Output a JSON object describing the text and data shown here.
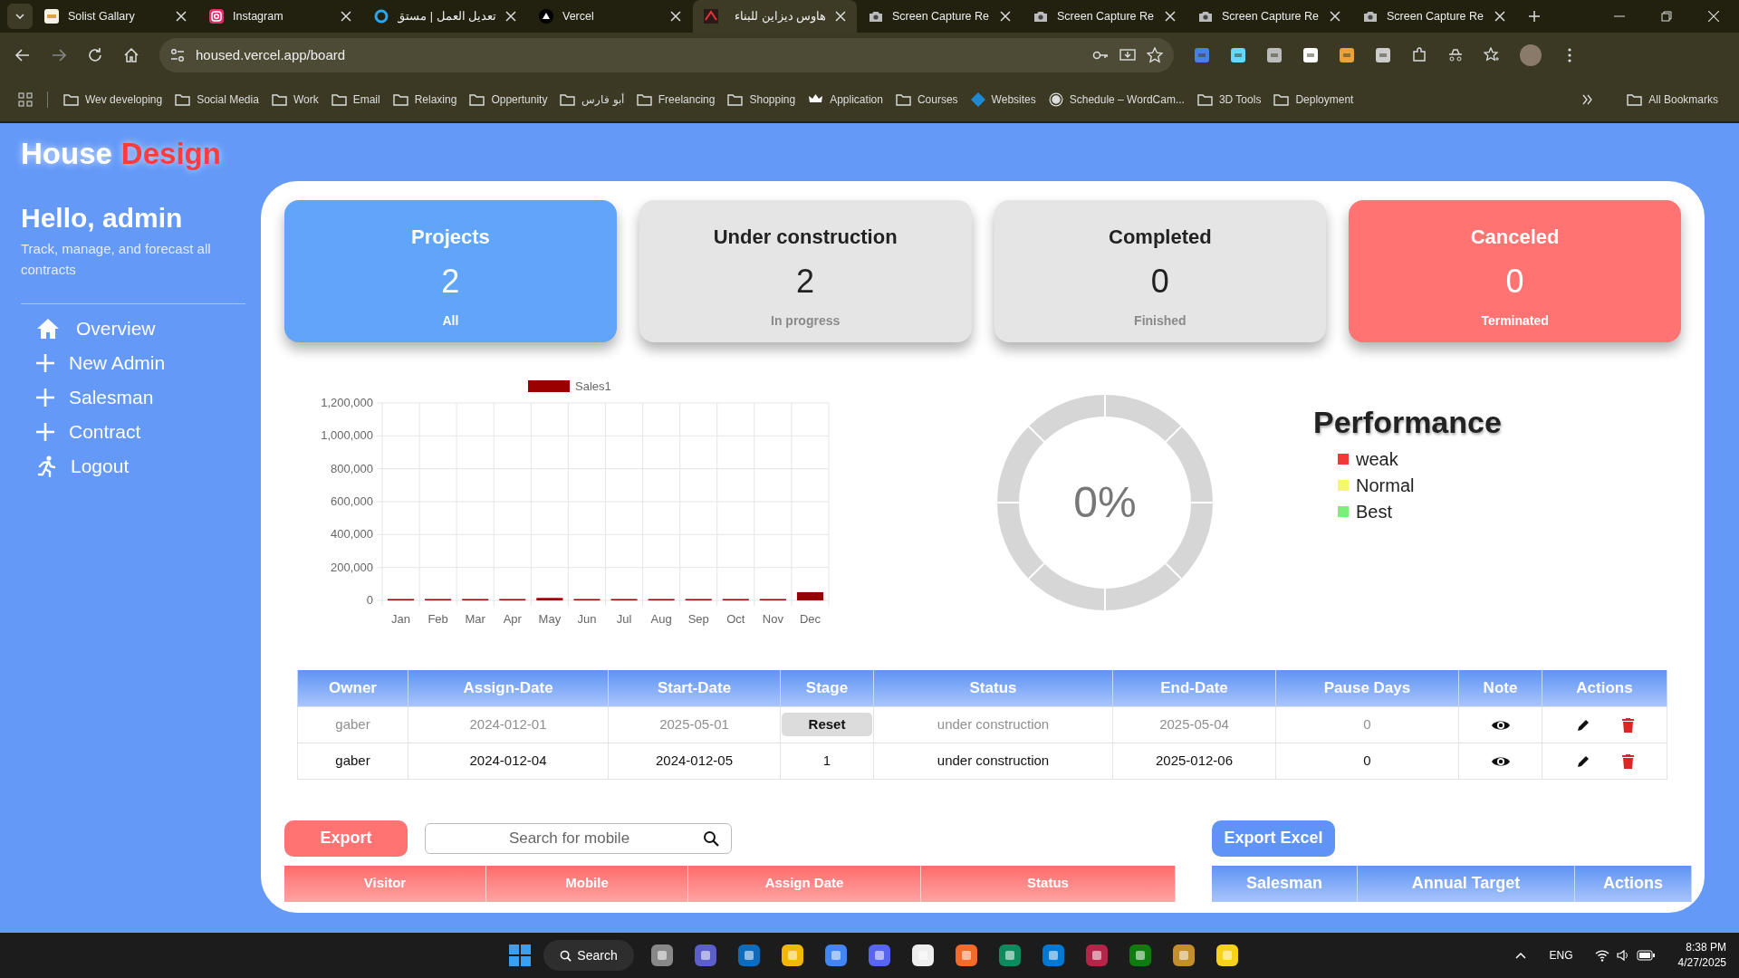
{
  "browser": {
    "tabs": [
      {
        "title": "Solist Gallary",
        "selected": false
      },
      {
        "title": "Instagram",
        "selected": false
      },
      {
        "title": "تعديل العمل | مستق",
        "selected": false
      },
      {
        "title": "Vercel",
        "selected": false
      },
      {
        "title": "هاوس ديزاين للبناء",
        "selected": true
      },
      {
        "title": "Screen Capture Re",
        "selected": false
      },
      {
        "title": "Screen Capture Re",
        "selected": false
      },
      {
        "title": "Screen Capture Re",
        "selected": false
      },
      {
        "title": "Screen Capture Re",
        "selected": false
      }
    ],
    "address": "housed.vercel.app/board",
    "bookmarks": [
      "Wev developing",
      "Social Media",
      "Work",
      "Email",
      "Relaxing",
      "Oppertunity",
      "أبو فارس",
      "Freelancing",
      "Shopping",
      "Application",
      "Courses",
      "Websites",
      "Schedule – WordCam...",
      "3D Tools",
      "Deployment"
    ],
    "all_bookmarks": "All Bookmarks"
  },
  "app": {
    "logo_first": "House",
    "logo_second": "Design",
    "greeting": "Hello, admin",
    "tagline": "Track, manage, and forecast all contracts",
    "nav": [
      {
        "label": "Overview",
        "kind": "home"
      },
      {
        "label": "New Admin",
        "kind": "add"
      },
      {
        "label": "Salesman",
        "kind": "add"
      },
      {
        "label": "Contract",
        "kind": "add"
      },
      {
        "label": "Logout",
        "kind": "logout"
      }
    ]
  },
  "cards": [
    {
      "title": "Projects",
      "value": "2",
      "caption": "All",
      "color": "#60a5fa"
    },
    {
      "title": "Under construction",
      "value": "2",
      "caption": "In progress",
      "color": "#e5e5e5"
    },
    {
      "title": "Completed",
      "value": "0",
      "caption": "Finished",
      "color": "#e5e5e5"
    },
    {
      "title": "Canceled",
      "value": "0",
      "caption": "Terminated",
      "color": "#ff7373"
    }
  ],
  "sales_chart": {
    "chart_data": {
      "type": "bar",
      "categories": [
        "Jan",
        "Feb",
        "Mar",
        "Apr",
        "May",
        "Jun",
        "Jul",
        "Aug",
        "Sep",
        "Oct",
        "Nov",
        "Dec"
      ],
      "series": [
        {
          "name": "Sales1",
          "color": "#990000",
          "values": [
            0,
            0,
            0,
            0,
            15000,
            0,
            0,
            0,
            0,
            0,
            0,
            50000
          ]
        }
      ],
      "ylim": [
        0,
        1200000
      ],
      "grid": true,
      "yticks": [
        0,
        {
          "value": 200000,
          "label": "200,000"
        },
        {
          "value": 400000,
          "label": "400,000"
        },
        {
          "value": 600000,
          "label": "600,000"
        },
        {
          "value": 800000,
          "label": "800,000"
        },
        {
          "value": 1000000,
          "label": "1,000,000"
        },
        {
          "value": 1200000,
          "label": "1,200,000"
        }
      ]
    }
  },
  "performance": {
    "percent": "0%",
    "title": "Performance",
    "legend": [
      {
        "label": "weak",
        "color": "#f03a3a"
      },
      {
        "label": "Normal",
        "color": "#f7f76a"
      },
      {
        "label": "Best",
        "color": "#7af07a"
      }
    ]
  },
  "contracts": {
    "columns": [
      "Owner",
      "Assign-Date",
      "Start-Date",
      "Stage",
      "Status",
      "End-Date",
      "Pause Days",
      "Note",
      "Actions"
    ],
    "rows": [
      {
        "owner": "gaber",
        "assign_date": "2024-012-01",
        "start_date": "2025-05-01",
        "stage_button": "Reset",
        "status": "under construction",
        "end_date": "2025-05-04",
        "pause_days": "0",
        "faded": true
      },
      {
        "owner": "gaber",
        "assign_date": "2024-012-04",
        "start_date": "2024-012-05",
        "stage": "1",
        "status": "under construction",
        "end_date": "2025-012-06",
        "pause_days": "0",
        "faded": false
      }
    ]
  },
  "visitors": {
    "export": "Export",
    "search_placeholder": "Search for mobile",
    "columns": [
      "Visitor",
      "Mobile",
      "Assign Date",
      "Status"
    ]
  },
  "salesmen": {
    "export": "Export Excel",
    "columns": [
      "Salesman",
      "Annual Target",
      "Actions"
    ]
  },
  "taskbar": {
    "search": "Search",
    "language": "ENG",
    "time": "8:38 PM",
    "date": "4/27/2025"
  }
}
